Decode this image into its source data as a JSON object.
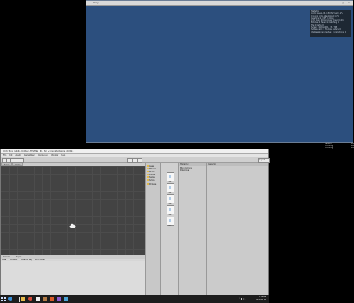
{
  "game_window": {
    "title": "Unity",
    "controls": [
      "–",
      "□",
      "×"
    ],
    "stats_overlay": [
      "Statistics",
      "Audio: Level  -74.8 dB   DSP load 0.2%",
      "Clipping  0.0%   Stream load 0.0%",
      "Graphics:              0.0 FPS (0.0ms)",
      "CPU: main 0.0ms  render thread 0.0ms",
      "Batches: 0  Saved by batching: 0",
      "Tris: 0   Verts: 0",
      "Screen: 1920x1080 - 23.7 MB",
      "SetPass calls: 0  Shadow casters: 0",
      "Visible skinned meshes: 0  Animations: 0"
    ]
  },
  "side_list": [
    {
      "label": "Version",
      "value": "0.0"
    },
    {
      "label": "FPS Ring",
      "value": "0.0"
    },
    {
      "label": "FPS Ring",
      "value": "0.0"
    }
  ],
  "editor": {
    "title": "Unity 5.x.x (64bit) - Untitled - TESTING - PC, Mac & Linux Standalone <DX11>",
    "menu": [
      "File",
      "Edit",
      "Assets",
      "GameObject",
      "Component",
      "Window",
      "Help"
    ],
    "layout_label": "Layout",
    "scene_tabs": [
      "Scene",
      "Game"
    ],
    "console_tabs": [
      "Console",
      "Project"
    ],
    "console_bar": [
      "Clear",
      "Collapse",
      "Clear on Play",
      "Error Pause"
    ],
    "project_folders": [
      "Assets",
      "Materials",
      "Models",
      "Prefabs",
      "Scenes",
      "Scripts",
      "Packages"
    ],
    "project_files": [
      "file1",
      "file2",
      "file3",
      "file4",
      "file5"
    ],
    "hierarchy_tab": "Hierarchy",
    "hierarchy_rows": [
      "Main Camera",
      "Directional"
    ],
    "inspector_tab": "Inspector"
  },
  "taskbar": {
    "tray_time": "1:43 PM",
    "tray_date": "2019-08-14",
    "icons": [
      "start-icon",
      "cortana-icon",
      "task-view-icon",
      "explorer-icon",
      "chrome-icon",
      "unity-icon",
      "app-icon",
      "app-icon2",
      "vs-icon",
      "app-icon3"
    ],
    "colors": {
      "start": "#cfe0ff",
      "cortana": "#3a8fd6",
      "task_view": "#dddddd",
      "explorer": "#e5b94a",
      "chrome": "#d24b3c",
      "unity": "#f0f0f0",
      "app": "#b27a45",
      "app2": "#d85a2a",
      "vs": "#8e5ad0",
      "app3": "#4aa3d5"
    }
  }
}
